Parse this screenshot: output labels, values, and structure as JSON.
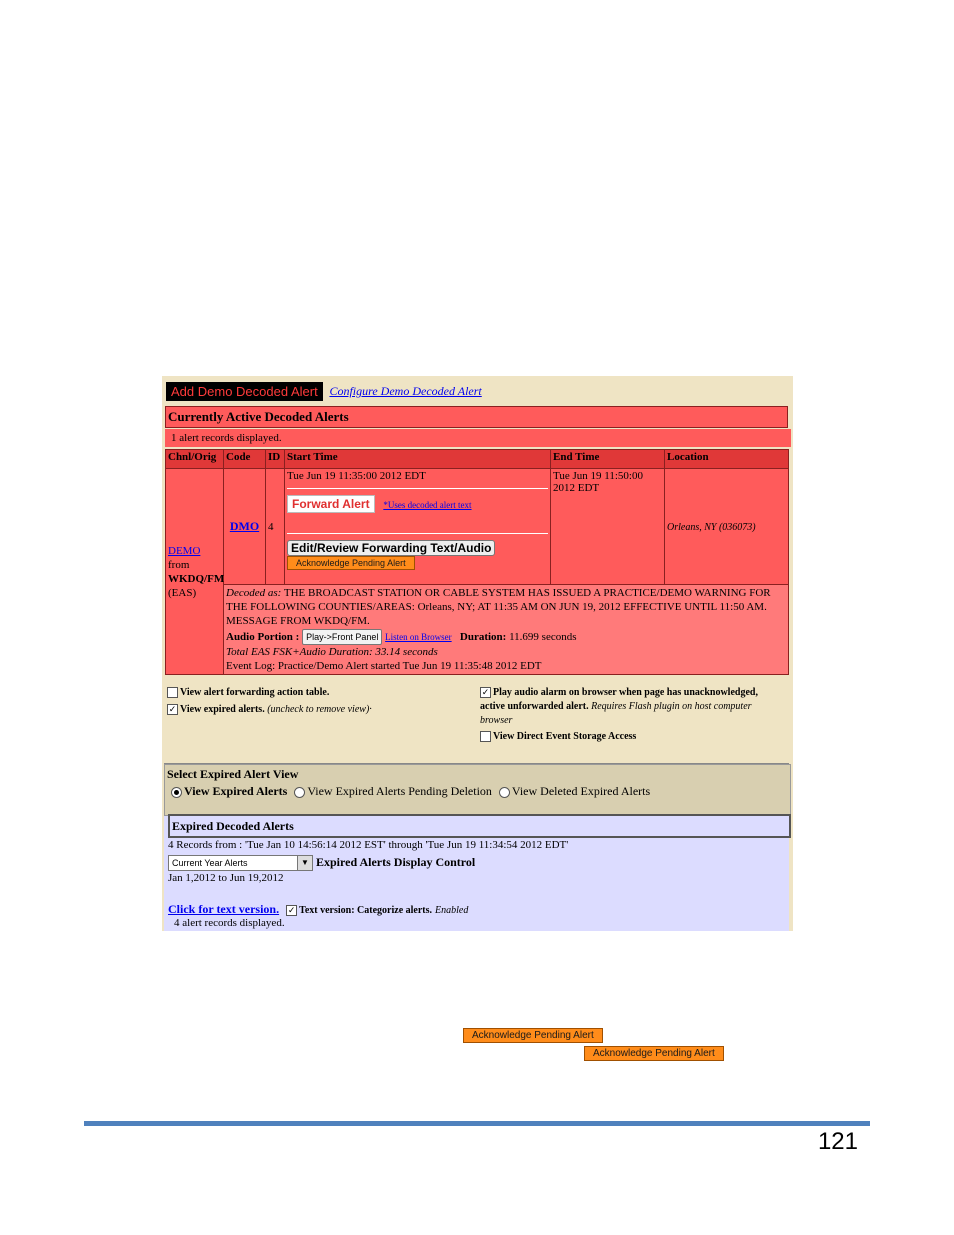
{
  "screenshot": {
    "add_demo_button": "Add Demo Decoded Alert",
    "configure_link": "Configure Demo Decoded Alert",
    "active_title": "Currently Active Decoded Alerts",
    "records_displayed": "1 alert records displayed.",
    "table": {
      "headers": [
        "Chnl/Orig",
        "Code",
        "ID",
        "Start Time",
        "End Time",
        "Location"
      ],
      "row": {
        "chnl_link": "DEMO",
        "chnl_from": "from",
        "chnl_station": "WKDQ/FM",
        "chnl_type": "(EAS)",
        "code": "DMO",
        "id": "4",
        "start_time": "Tue Jun 19 11:35:00 2012 EDT",
        "forward_button": "Forward Alert",
        "uses_decoded_link": "*Uses decoded alert text",
        "edit_button": "Edit/Review Forwarding Text/Audio",
        "ack_button": "Acknowledge Pending Alert",
        "end_time": "Tue Jun 19 11:50:00 2012 EDT",
        "location": "Orleans, NY (036073)"
      },
      "detail": {
        "decoded_label": "Decoded as:",
        "decoded_text": "THE BROADCAST STATION OR CABLE SYSTEM HAS ISSUED A PRACTICE/DEMO WARNING FOR THE FOLLOWING COUNTIES/AREAS: Orleans, NY; AT 11:35 AM ON JUN 19, 2012 EFFECTIVE UNTIL 11:50 AM. MESSAGE FROM WKDQ/FM.",
        "audio_label": "Audio Portion :",
        "play_button": "Play->Front Panel",
        "listen_link": "Listen on Browser",
        "duration_label": "Duration:",
        "duration_value": "11.699 seconds",
        "total_duration": "Total EAS FSK+Audio Duration: 33.14 seconds",
        "event_log": "Event Log: Practice/Demo Alert started Tue Jun 19 11:35:48 2012 EDT"
      }
    },
    "options": {
      "view_forwarding": "View alert forwarding action table.",
      "view_expired": "View expired alerts.",
      "view_expired_note": "(uncheck to remove view)·",
      "play_audio": "Play audio alarm on browser when page has unacknowledged, active unforwarded alert.",
      "play_audio_note": "Requires Flash plugin on host computer browser",
      "direct_storage": "View Direct Event Storage Access"
    },
    "expired_view": {
      "title": "Select Expired Alert View",
      "radios": [
        "View Expired Alerts",
        "View Expired Alerts Pending Deletion",
        "View Deleted Expired Alerts"
      ],
      "panel_title": "Expired Decoded Alerts",
      "records_range": "4 Records from : 'Tue Jan 10 14:56:14 2012 EST' through 'Tue Jun 19 11:34:54 2012 EDT'",
      "dropdown_value": "Current Year Alerts",
      "display_control": "Expired Alerts Display Control",
      "date_range": "Jan 1,2012 to Jun 19,2012",
      "text_version_link": "Click for text version.",
      "text_version_label": "Text version: Categorize alerts.",
      "enabled": "Enabled",
      "alerts_displayed": "4 alert records displayed."
    }
  },
  "floating_ack_1": "Acknowledge Pending Alert",
  "floating_ack_2": "Acknowledge Pending Alert",
  "page_number": "121"
}
